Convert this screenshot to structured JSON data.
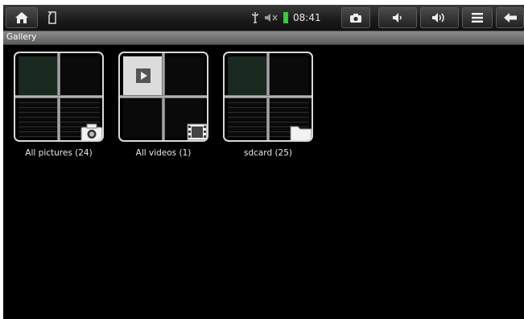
{
  "statusbar": {
    "clock": "08:41",
    "icons": [
      "home-icon",
      "sdcard-icon",
      "usb-icon",
      "mute-icon",
      "battery-icon",
      "camera-icon",
      "volume-down-icon",
      "volume-up-icon",
      "menu-icon",
      "back-icon"
    ]
  },
  "gallery": {
    "title": "Gallery",
    "albums": [
      {
        "label": "All pictures (24)",
        "badge": "camera-icon"
      },
      {
        "label": "All videos (1)",
        "badge": "film-icon"
      },
      {
        "label": "sdcard (25)",
        "badge": "folder-icon"
      }
    ]
  },
  "colors": {
    "background": "#000000",
    "bar": "#2a2a2a",
    "title_bar": "#6e6e6e",
    "battery": "#33cc33"
  }
}
